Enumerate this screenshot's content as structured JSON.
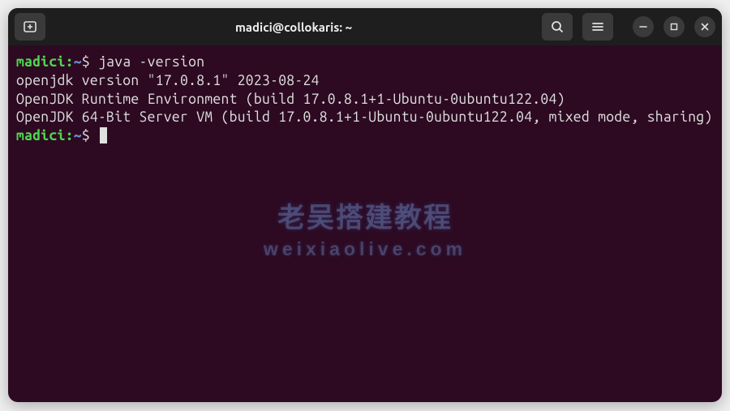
{
  "titlebar": {
    "title": "madici@collokaris: ~"
  },
  "terminal": {
    "prompt_user": "madici",
    "prompt_sep": ":",
    "prompt_path": "~",
    "prompt_dollar": "$ ",
    "command1": "java -version",
    "output1": "openjdk version \"17.0.8.1\" 2023-08-24",
    "output2": "OpenJDK Runtime Environment (build 17.0.8.1+1-Ubuntu-0ubuntu122.04)",
    "output3": "OpenJDK 64-Bit Server VM (build 17.0.8.1+1-Ubuntu-0ubuntu122.04, mixed mode, sharing)"
  },
  "watermark": {
    "main": "老吴搭建教程",
    "sub": "weixiaolive.com"
  }
}
